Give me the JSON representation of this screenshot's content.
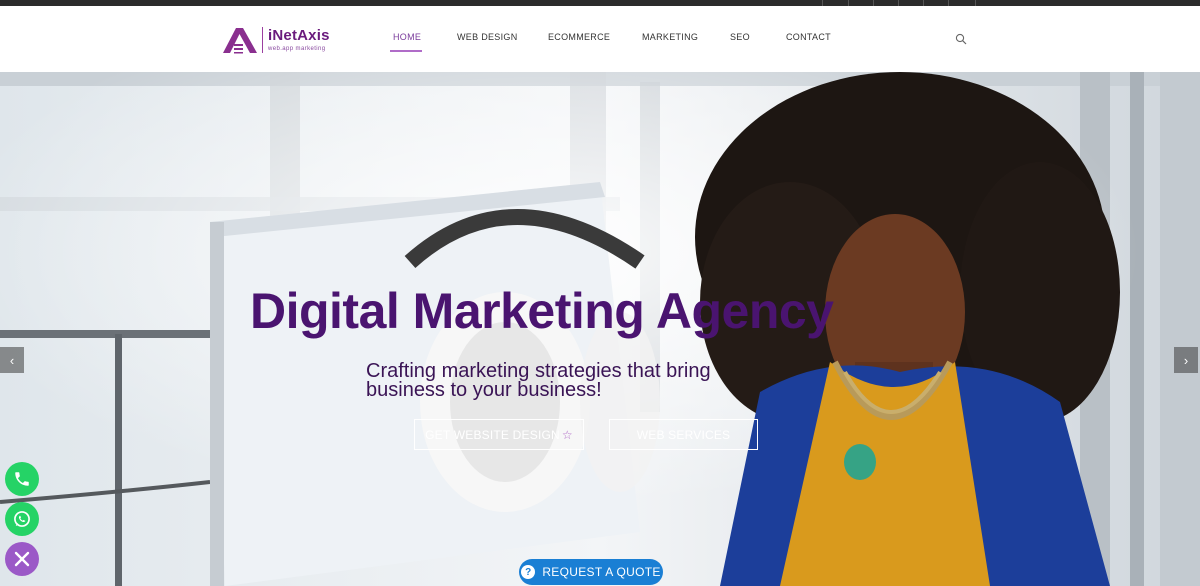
{
  "brand": {
    "name": "iNetAxis",
    "tagline": "web.app marketing",
    "color": "#6a1b7d"
  },
  "nav": {
    "items": [
      {
        "label": "HOME",
        "active": true
      },
      {
        "label": "WEB DESIGN",
        "active": false
      },
      {
        "label": "ECOMMERCE",
        "active": false
      },
      {
        "label": "MARKETING",
        "active": false
      },
      {
        "label": "SEO",
        "active": false
      },
      {
        "label": "CONTACT",
        "active": false
      }
    ],
    "search_icon": "search-icon"
  },
  "hero": {
    "title": "Digital Marketing Agency",
    "subtitle": "Crafting marketing strategies that bring business to your business!",
    "primary_button": "GET WEBSITE DESIGN",
    "primary_button_icon": "star-icon",
    "secondary_button": "WEB SERVICES",
    "prev_icon": "chevron-left-icon",
    "next_icon": "chevron-right-icon"
  },
  "floating": {
    "phone_icon": "phone-icon",
    "whatsapp_icon": "whatsapp-icon",
    "close_icon": "close-icon"
  },
  "quote_button": {
    "label": "REQUEST A QUOTE",
    "icon": "question-icon",
    "color": "#1a7fd4"
  },
  "colors": {
    "accent": "#7a3b9b",
    "title": "#4a1470",
    "whatsapp_green": "#25d366",
    "close_purple": "#9b59c7"
  }
}
